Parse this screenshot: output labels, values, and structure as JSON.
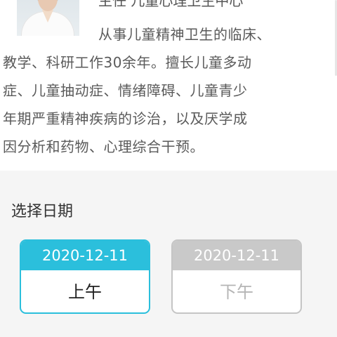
{
  "doctor": {
    "title": "主任 儿童心理卫生中心",
    "bio_lines": [
      "从事儿童精神卫生的临床、",
      "教学、科研工作30余年。擅长儿童多动",
      "症、儿童抽动症、情绪障碍、儿童青少",
      "年期严重精神疾病的诊治，以及厌学成",
      "因分析和药物、心理综合干预。"
    ]
  },
  "schedule": {
    "section_title": "选择日期",
    "slots": [
      {
        "date": "2020-12-11",
        "period": "上午",
        "available": true
      },
      {
        "date": "2020-12-11",
        "period": "下午",
        "available": false
      }
    ]
  },
  "colors": {
    "accent": "#2bbfdc",
    "disabled": "#c9c9c9"
  }
}
